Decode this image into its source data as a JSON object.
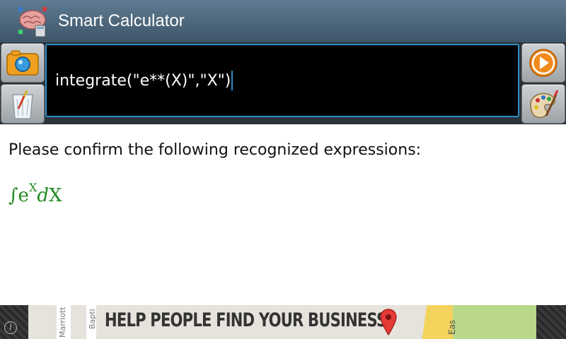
{
  "app": {
    "title": "Smart Calculator",
    "icon": "brain-calculator-icon"
  },
  "toolbar": {
    "camera_icon": "camera-icon",
    "trash_icon": "trash-icon",
    "run_icon": "play-icon",
    "paint_icon": "palette-icon",
    "input_value": "integrate(\"e**(X)\",\"X\")"
  },
  "content": {
    "prompt": "Please confirm the following recognized expressions:",
    "expression": {
      "integral": "∫",
      "base": "e",
      "exponent": "X",
      "differential": "d",
      "variable": "X"
    },
    "expression_color": "#228b22"
  },
  "ad": {
    "headline": "HELP PEOPLE FIND YOUR BUSINESS",
    "street_1": "Marriott",
    "street_2": "Bapti",
    "street_3": "Eas",
    "info_glyph": "i"
  },
  "colors": {
    "titlebar": "#4f6a80",
    "input_border": "#2f8fc9",
    "run_button": "#f08a1c"
  }
}
